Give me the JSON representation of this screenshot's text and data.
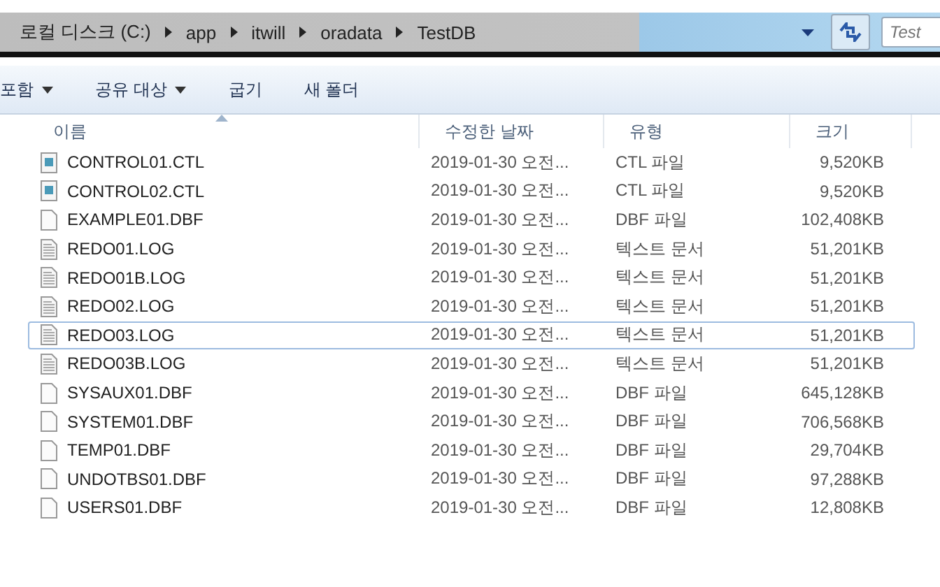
{
  "address_bar": {
    "segments": [
      "로컬 디스크 (C:)",
      "app",
      "itwill",
      "oradata",
      "TestDB"
    ]
  },
  "search": {
    "placeholder": "Test"
  },
  "toolbar": [
    {
      "label": "포함",
      "has_menu": true
    },
    {
      "label": "공유 대상",
      "has_menu": true
    },
    {
      "label": "굽기",
      "has_menu": false
    },
    {
      "label": "새 폴더",
      "has_menu": false
    }
  ],
  "table": {
    "columns": [
      {
        "label": "이름",
        "sorted": true
      },
      {
        "label": "수정한 날짜",
        "sorted": false
      },
      {
        "label": "유형",
        "sorted": false
      },
      {
        "label": "크기",
        "sorted": false
      }
    ],
    "rows": [
      {
        "kind": "ctl",
        "name": "CONTROL01.CTL",
        "date": "2019-01-30 오전...",
        "type": "CTL 파일",
        "size": "9,520KB",
        "selected": false
      },
      {
        "kind": "ctl",
        "name": "CONTROL02.CTL",
        "date": "2019-01-30 오전...",
        "type": "CTL 파일",
        "size": "9,520KB",
        "selected": false
      },
      {
        "kind": "blank",
        "name": "EXAMPLE01.DBF",
        "date": "2019-01-30 오전...",
        "type": "DBF 파일",
        "size": "102,408KB",
        "selected": false
      },
      {
        "kind": "text",
        "name": "REDO01.LOG",
        "date": "2019-01-30 오전...",
        "type": "텍스트 문서",
        "size": "51,201KB",
        "selected": false
      },
      {
        "kind": "text",
        "name": "REDO01B.LOG",
        "date": "2019-01-30 오전...",
        "type": "텍스트 문서",
        "size": "51,201KB",
        "selected": false
      },
      {
        "kind": "text",
        "name": "REDO02.LOG",
        "date": "2019-01-30 오전...",
        "type": "텍스트 문서",
        "size": "51,201KB",
        "selected": false
      },
      {
        "kind": "text",
        "name": "REDO03.LOG",
        "date": "2019-01-30 오전...",
        "type": "텍스트 문서",
        "size": "51,201KB",
        "selected": true
      },
      {
        "kind": "text",
        "name": "REDO03B.LOG",
        "date": "2019-01-30 오전...",
        "type": "텍스트 문서",
        "size": "51,201KB",
        "selected": false
      },
      {
        "kind": "blank",
        "name": "SYSAUX01.DBF",
        "date": "2019-01-30 오전...",
        "type": "DBF 파일",
        "size": "645,128KB",
        "selected": false
      },
      {
        "kind": "blank",
        "name": "SYSTEM01.DBF",
        "date": "2019-01-30 오전...",
        "type": "DBF 파일",
        "size": "706,568KB",
        "selected": false
      },
      {
        "kind": "blank",
        "name": "TEMP01.DBF",
        "date": "2019-01-30 오전...",
        "type": "DBF 파일",
        "size": "29,704KB",
        "selected": false
      },
      {
        "kind": "blank",
        "name": "UNDOTBS01.DBF",
        "date": "2019-01-30 오전...",
        "type": "DBF 파일",
        "size": "97,288KB",
        "selected": false
      },
      {
        "kind": "blank",
        "name": "USERS01.DBF",
        "date": "2019-01-30 오전...",
        "type": "DBF 파일",
        "size": "12,808KB",
        "selected": false
      }
    ]
  }
}
